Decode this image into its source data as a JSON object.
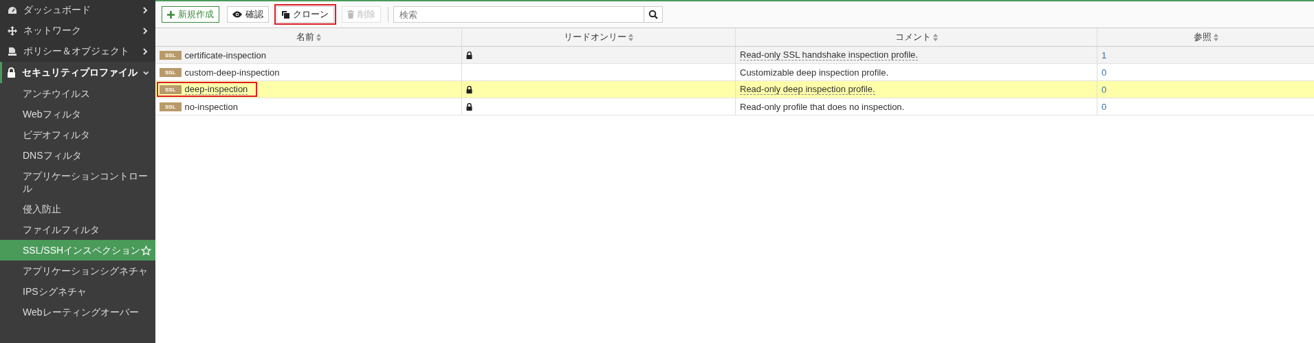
{
  "sidebar": {
    "items": [
      {
        "label": "ダッシュボード",
        "expanded": false
      },
      {
        "label": "ネットワーク",
        "expanded": false
      },
      {
        "label": "ポリシー＆オブジェクト",
        "expanded": false
      },
      {
        "label": "セキュリティプロファイル",
        "expanded": true,
        "children": [
          {
            "label": "アンチウイルス",
            "selected": false
          },
          {
            "label": "Webフィルタ",
            "selected": false
          },
          {
            "label": "ビデオフィルタ",
            "selected": false
          },
          {
            "label": "DNSフィルタ",
            "selected": false
          },
          {
            "label": "アプリケーションコントロール",
            "selected": false
          },
          {
            "label": "侵入防止",
            "selected": false
          },
          {
            "label": "ファイルフィルタ",
            "selected": false
          },
          {
            "label": "SSL/SSHインスペクション",
            "selected": true
          },
          {
            "label": "アプリケーションシグネチャ",
            "selected": false
          },
          {
            "label": "IPSシグネチャ",
            "selected": false
          },
          {
            "label": "Webレーティングオーバー",
            "selected": false
          }
        ]
      }
    ]
  },
  "toolbar": {
    "buttons": [
      {
        "kind": "create",
        "label": "新規作成",
        "disabled": false,
        "highlighted": false
      },
      {
        "kind": "view",
        "label": "確認",
        "disabled": false,
        "highlighted": false
      },
      {
        "kind": "clone",
        "label": "クローン",
        "disabled": false,
        "highlighted": true
      },
      {
        "kind": "delete",
        "label": "削除",
        "disabled": true,
        "highlighted": false
      }
    ],
    "search": {
      "placeholder": "検索"
    }
  },
  "table": {
    "columns": [
      "名前",
      "リードオンリー",
      "コメント",
      "参照"
    ],
    "rows": [
      {
        "badge": "SSL",
        "name": "certificate-inspection",
        "readonly": true,
        "comment": "Read-only SSL handshake inspection profile.",
        "references": "1",
        "hovered": true,
        "selected": false,
        "highlighted": false
      },
      {
        "badge": "SSL",
        "name": "custom-deep-inspection",
        "readonly": false,
        "comment": "Customizable deep inspection profile.",
        "references": "0",
        "hovered": false,
        "selected": false,
        "highlighted": false
      },
      {
        "badge": "SSL",
        "name": "deep-inspection",
        "readonly": true,
        "comment": "Read-only deep inspection profile.",
        "references": "0",
        "hovered": false,
        "selected": true,
        "highlighted": true
      },
      {
        "badge": "SSL",
        "name": "no-inspection",
        "readonly": true,
        "comment": "Read-only profile that does no inspection.",
        "references": "0",
        "hovered": false,
        "selected": false,
        "highlighted": false
      }
    ]
  }
}
